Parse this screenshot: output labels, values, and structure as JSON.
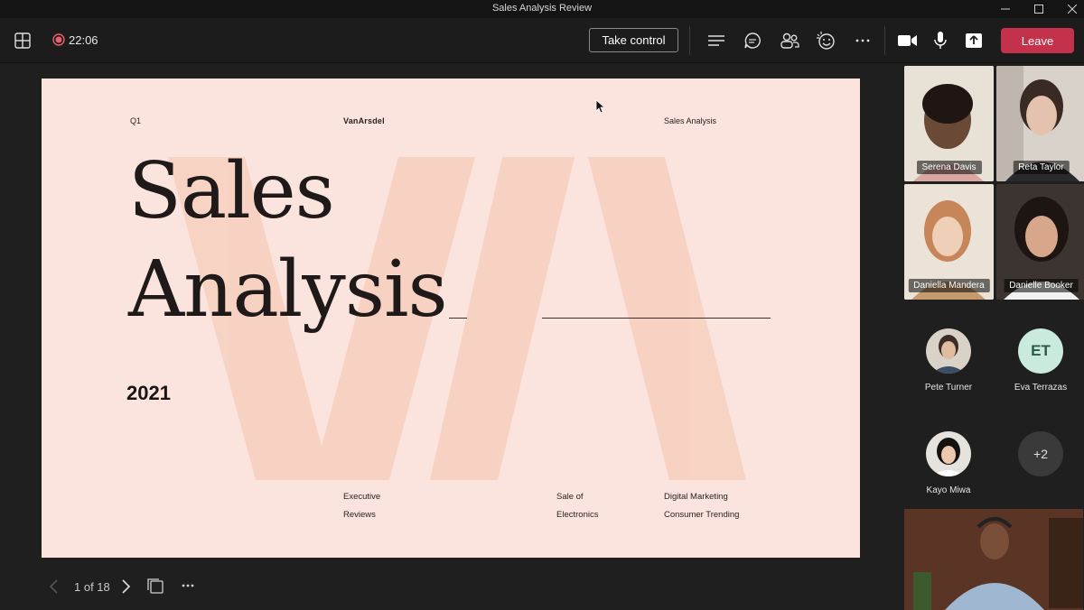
{
  "window": {
    "title": "Sales Analysis Review"
  },
  "toolbar": {
    "timer": "22:06",
    "take_control_label": "Take control",
    "leave_label": "Leave"
  },
  "slide": {
    "top_left": "Q1",
    "brand": "VanArsdel",
    "top_right": "Sales Analysis",
    "title_line1": "Sales",
    "title_line2": "Analysis",
    "year": "2021",
    "footer": [
      {
        "line1": "Executive",
        "line2": "Reviews"
      },
      {
        "line1": "Sale of",
        "line2": "Electronics"
      },
      {
        "line1": "Digital Marketing",
        "line2": "Consumer Trending"
      }
    ]
  },
  "slide_nav": {
    "page_indicator": "1 of 18"
  },
  "participants": {
    "video_tiles": [
      {
        "name": "Serena Davis"
      },
      {
        "name": "Reta Taylor"
      },
      {
        "name": "Daniella Mandera"
      },
      {
        "name": "Danielle Booker"
      }
    ],
    "roster": [
      {
        "name": "Pete Turner"
      },
      {
        "name": "Eva Terrazas",
        "initials": "ET"
      },
      {
        "name": "Kayo Miwa"
      },
      {
        "more": "+2"
      }
    ]
  },
  "colors": {
    "leave": "#c4314b",
    "slide_bg": "#fbe4dd",
    "app_bg": "#1f1f1f"
  },
  "icons": [
    "layout-icon",
    "record-icon",
    "chat-list-icon",
    "chat-icon",
    "people-icon",
    "reactions-icon",
    "more-icon",
    "camera-icon",
    "mic-icon",
    "share-icon"
  ]
}
